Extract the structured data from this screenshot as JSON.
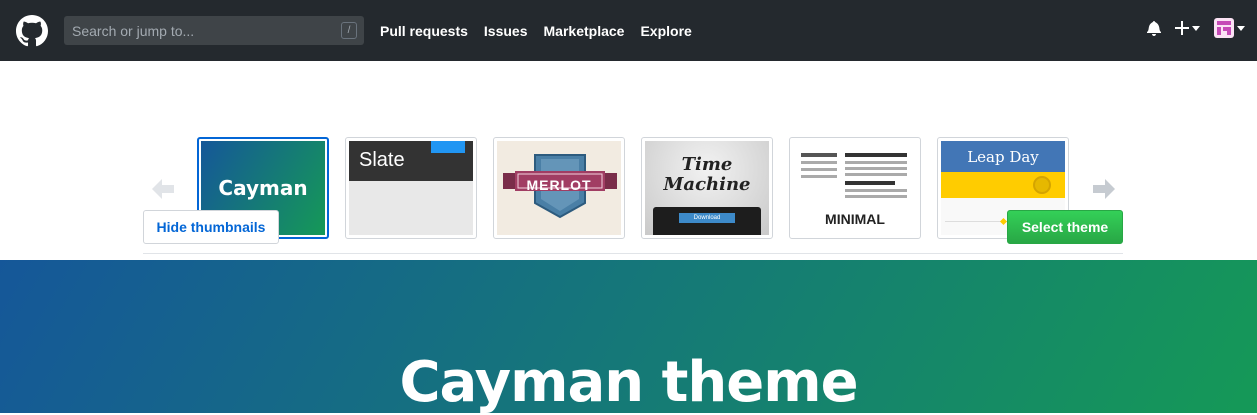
{
  "header": {
    "search_placeholder": "Search or jump to...",
    "search_shortcut": "/",
    "nav": [
      "Pull requests",
      "Issues",
      "Marketplace",
      "Explore"
    ]
  },
  "themes": {
    "cayman": "Cayman",
    "slate": "Slate",
    "merlot": "MERLOT",
    "time_machine": [
      "Time",
      "Machine"
    ],
    "time_machine_button": "Download",
    "minimal": "MINIMAL",
    "leap_day": "Leap Day"
  },
  "actions": {
    "hide_thumbnails": "Hide thumbnails",
    "select_theme": "Select theme"
  },
  "hero": {
    "title": "Cayman theme"
  },
  "colors": {
    "header_bg": "#24292e",
    "cayman_start": "#155799",
    "cayman_end": "#159957",
    "select_green": "#28a745",
    "link_blue": "#0366d6"
  }
}
